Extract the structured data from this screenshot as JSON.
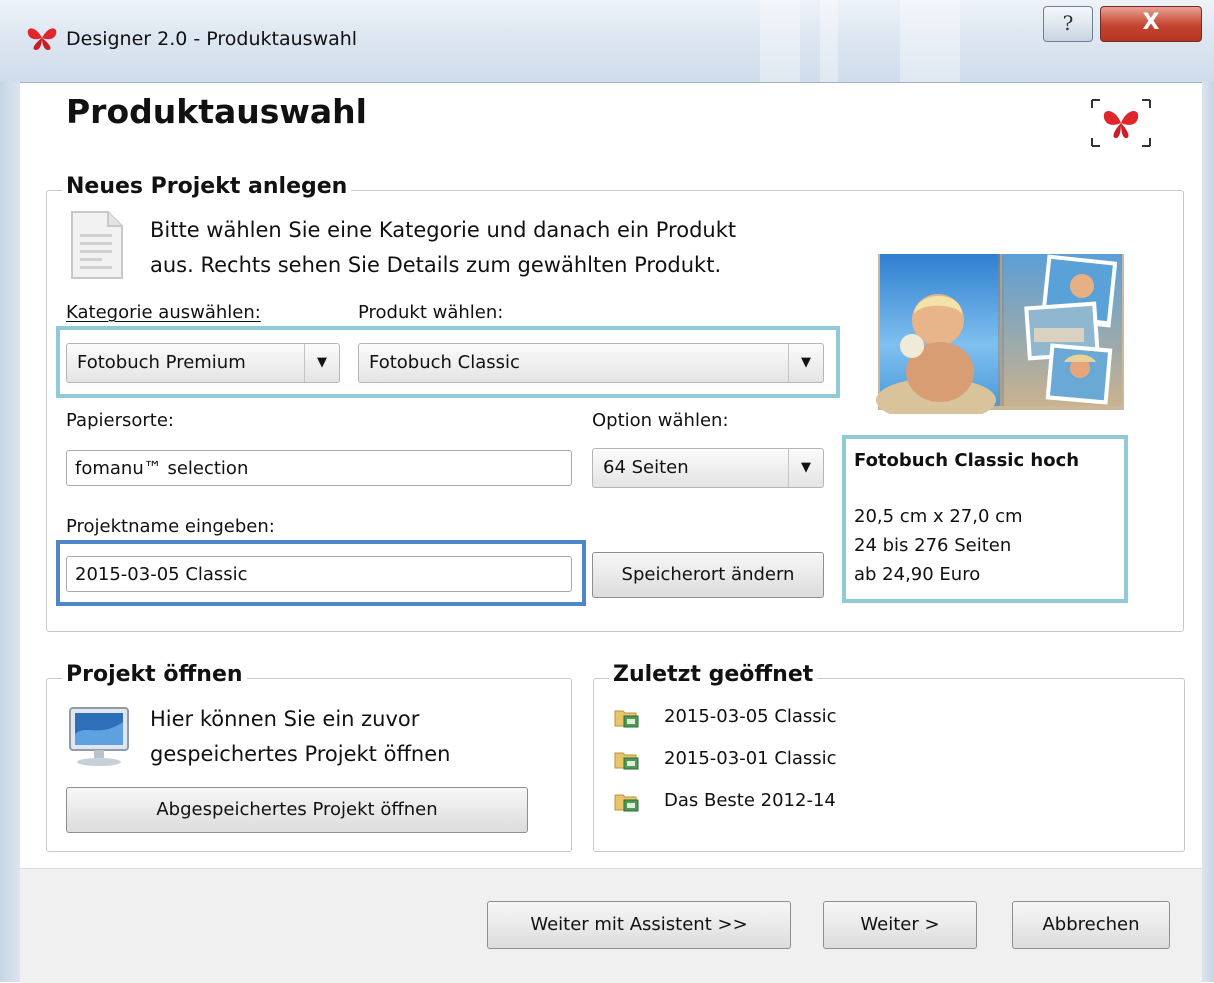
{
  "window": {
    "title": "Designer 2.0 - Produktauswahl",
    "help_label": "?",
    "close_label": "X"
  },
  "page": {
    "title": "Produktauswahl"
  },
  "new_project": {
    "group_title": "Neues Projekt anlegen",
    "description_line1": "Bitte wählen Sie eine Kategorie und danach ein Produkt",
    "description_line2": "aus. Rechts sehen Sie Details zum gewählten Produkt.",
    "category_label": "Kategorie auswählen:",
    "category_value": "Fotobuch Premium",
    "product_label": "Produkt wählen:",
    "product_value": "Fotobuch Classic",
    "paper_label": "Papiersorte:",
    "paper_value": "fomanu™ selection",
    "option_label": "Option wählen:",
    "option_value": "64 Seiten",
    "project_name_label": "Projektname eingeben:",
    "project_name_value": "2015-03-05 Classic",
    "save_location_button": "Speicherort ändern"
  },
  "product_details": {
    "name": "Fotobuch Classic hoch",
    "size": "20,5 cm x 27,0 cm",
    "pages": "24 bis 276 Seiten",
    "price": "ab 24,90 Euro"
  },
  "open_project": {
    "group_title": "Projekt öffnen",
    "description_line1": "Hier können Sie ein zuvor",
    "description_line2": "gespeichertes Projekt öffnen",
    "open_button": "Abgespeichertes Projekt öffnen"
  },
  "recent": {
    "group_title": "Zuletzt geöffnet",
    "items": [
      "2015-03-05 Classic",
      "2015-03-01 Classic",
      "Das Beste 2012-14"
    ]
  },
  "footer": {
    "assistant_button": "Weiter mit Assistent >>",
    "next_button": "Weiter >",
    "cancel_button": "Abbrechen"
  },
  "colors": {
    "brand_red": "#e0262b",
    "highlight_teal": "#90cad8",
    "highlight_blue": "#4f86c6"
  }
}
